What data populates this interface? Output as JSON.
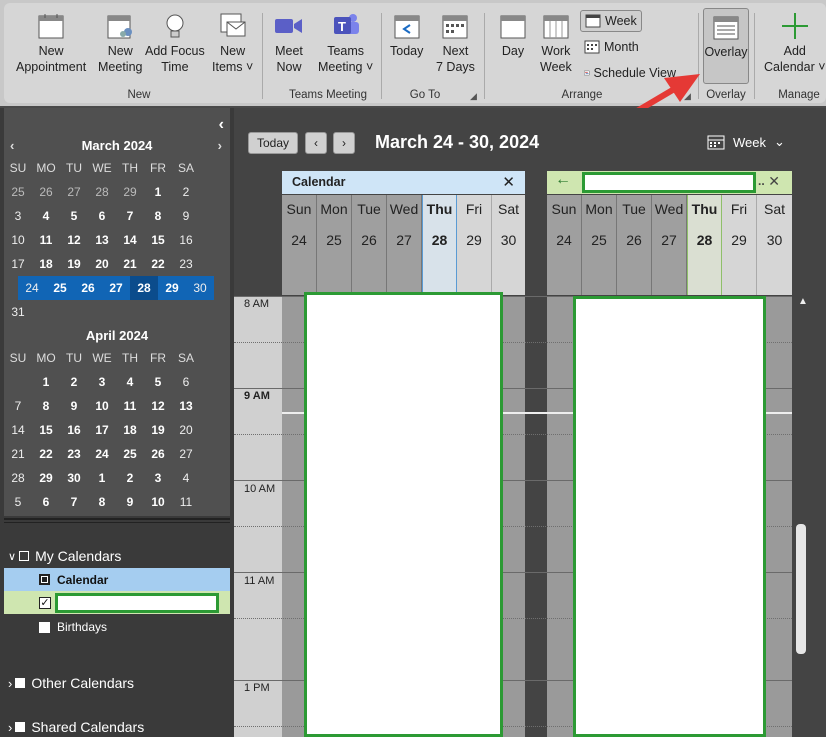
{
  "ribbon": {
    "new_appointment": "New\nAppointment",
    "new_meeting": "New\nMeeting",
    "new_focus_time": "Add Focus\nTime",
    "new_items": "New\nItems ˅",
    "group_new": "New",
    "meet_now": "Meet\nNow",
    "teams_meeting": "Teams\nMeeting ˅",
    "group_teams": "Teams Meeting",
    "today": "Today",
    "next7": "Next\n7 Days",
    "group_goto": "Go To",
    "day": "Day",
    "work_week": "Work\nWeek",
    "week": "Week",
    "month": "Month",
    "schedule_view": "Schedule View",
    "group_arrange": "Arrange",
    "overlay": "Overlay",
    "group_overlay": "Overlay",
    "add_calendar": "Add\nCalendar ˅",
    "group_manage": "Manage"
  },
  "nav": {
    "collapse_glyph": "‹",
    "march": {
      "title": "March 2024",
      "dow": [
        "SU",
        "MO",
        "TU",
        "WE",
        "TH",
        "FR",
        "SA"
      ],
      "weeks": [
        [
          "25",
          "26",
          "27",
          "28",
          "29",
          "1",
          "2"
        ],
        [
          "3",
          "4",
          "5",
          "6",
          "7",
          "8",
          "9"
        ],
        [
          "10",
          "11",
          "12",
          "13",
          "14",
          "15",
          "16"
        ],
        [
          "17",
          "18",
          "19",
          "20",
          "21",
          "22",
          "23"
        ],
        [
          "24",
          "25",
          "26",
          "27",
          "28",
          "29",
          "30"
        ],
        [
          "31",
          "",
          "",
          "",
          "",
          "",
          ""
        ]
      ]
    },
    "april": {
      "title": "April 2024",
      "dow": [
        "SU",
        "MO",
        "TU",
        "WE",
        "TH",
        "FR",
        "SA"
      ],
      "weeks": [
        [
          "",
          "1",
          "2",
          "3",
          "4",
          "5",
          "6"
        ],
        [
          "7",
          "8",
          "9",
          "10",
          "11",
          "12",
          "13"
        ],
        [
          "14",
          "15",
          "16",
          "17",
          "18",
          "19",
          "20"
        ],
        [
          "21",
          "22",
          "23",
          "24",
          "25",
          "26",
          "27"
        ],
        [
          "28",
          "29",
          "30",
          "1",
          "2",
          "3",
          "4"
        ],
        [
          "5",
          "6",
          "7",
          "8",
          "9",
          "10",
          "11"
        ]
      ]
    },
    "my_calendars": "My Calendars",
    "calendar_item": "Calendar",
    "birthdays_item": "Birthdays",
    "other_calendars": "Other Calendars",
    "shared_calendars": "Shared Calendars"
  },
  "main": {
    "today_btn": "Today",
    "date_range": "March 24 - 30, 2024",
    "view_label": "Week",
    "cal1_title": "Calendar",
    "days": [
      "Sun",
      "Mon",
      "Tue",
      "Wed",
      "Thu",
      "Fri",
      "Sat"
    ],
    "dates": [
      "24",
      "25",
      "26",
      "27",
      "28",
      "29",
      "30"
    ],
    "times": [
      "8 AM",
      "9 AM",
      "10 AM",
      "11 AM",
      "1 PM"
    ]
  },
  "colors": {
    "accent_green": "#2c9a34",
    "selected_blue": "#1165b5",
    "calendar_tab_blue": "#cfe5f7",
    "calendar_tab_green": "#cfe6b0"
  }
}
